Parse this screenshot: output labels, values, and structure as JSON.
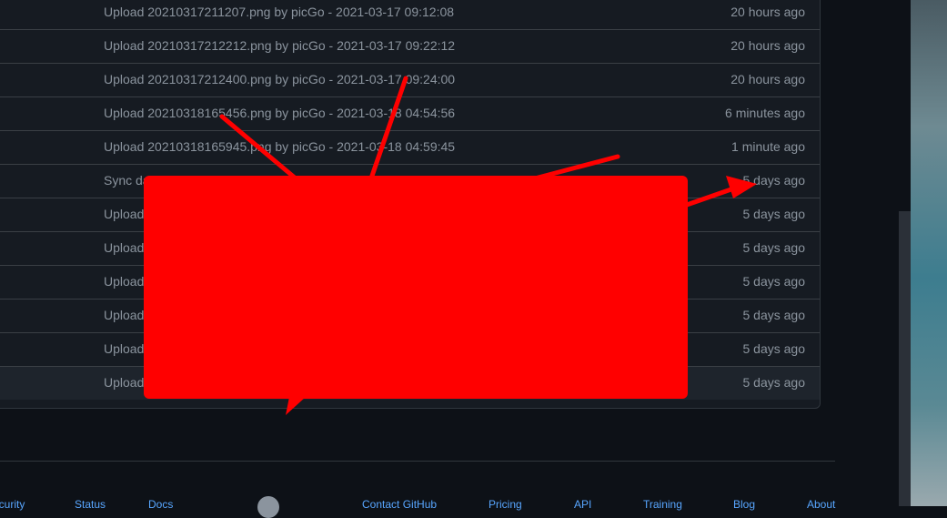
{
  "commits": [
    {
      "message": "Upload 20210317211207.png by picGo - 2021-03-17 09:12:08",
      "time": "20 hours ago"
    },
    {
      "message": "Upload 20210317212212.png by picGo - 2021-03-17 09:22:12",
      "time": "20 hours ago"
    },
    {
      "message": "Upload 20210317212400.png by picGo - 2021-03-17 09:24:00",
      "time": "20 hours ago"
    },
    {
      "message": "Upload 20210318165456.png by picGo - 2021-03-18 04:54:56",
      "time": "6 minutes ago"
    },
    {
      "message": "Upload 20210318165945.png by picGo - 2021-03-18 04:59:45",
      "time": "1 minute ago"
    },
    {
      "message": "Sync da",
      "time": "5 days ago"
    },
    {
      "message": "Upload",
      "time": "5 days ago"
    },
    {
      "message": "Upload",
      "time": "5 days ago"
    },
    {
      "message": "Upload",
      "time": "5 days ago"
    },
    {
      "message": "Upload",
      "time": "5 days ago"
    },
    {
      "message": "Upload",
      "time": "5 days ago"
    },
    {
      "message": "Upload",
      "time": "5 days ago"
    }
  ],
  "footer": {
    "links": [
      "Security",
      "Status",
      "Docs",
      "Contact GitHub",
      "Pricing",
      "API",
      "Training",
      "Blog",
      "About"
    ]
  },
  "colors": {
    "background": "#0d1117",
    "list_bg": "#161b22",
    "text_muted": "#8b949e",
    "link": "#58a6ff",
    "annotation_red": "#ff0000"
  },
  "icons": {
    "footer_logo": "github-octocat-icon"
  }
}
